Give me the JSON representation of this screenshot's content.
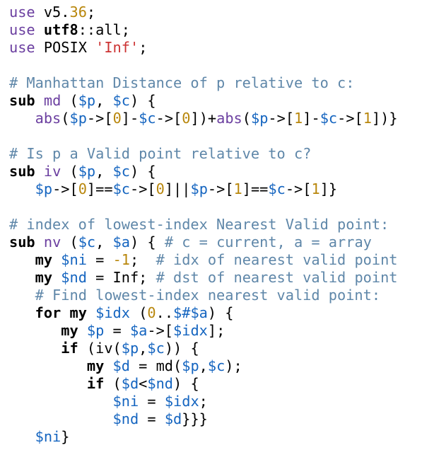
{
  "colors": {
    "keyword": "#000000",
    "pragma": "#6b3fa0",
    "number": "#b8860b",
    "string": "#cc3333",
    "comment": "#5f87a9",
    "variable": "#1565c0",
    "background": "#ffffff"
  },
  "lines": [
    [
      {
        "t": "pr",
        "v": "use"
      },
      {
        "t": "op",
        "v": " v5."
      },
      {
        "t": "num",
        "v": "36"
      },
      {
        "t": "op",
        "v": ";"
      }
    ],
    [
      {
        "t": "pr",
        "v": "use"
      },
      {
        "t": "op",
        "v": " "
      },
      {
        "t": "kw",
        "v": "utf8"
      },
      {
        "t": "op",
        "v": "::all;"
      }
    ],
    [
      {
        "t": "pr",
        "v": "use"
      },
      {
        "t": "op",
        "v": " POSIX "
      },
      {
        "t": "str",
        "v": "'Inf'"
      },
      {
        "t": "op",
        "v": ";"
      }
    ],
    [],
    [
      {
        "t": "cm",
        "v": "# Manhattan Distance of p relative to c:"
      }
    ],
    [
      {
        "t": "kw",
        "v": "sub"
      },
      {
        "t": "op",
        "v": " "
      },
      {
        "t": "fn",
        "v": "md"
      },
      {
        "t": "op",
        "v": " ("
      },
      {
        "t": "var",
        "v": "$p"
      },
      {
        "t": "op",
        "v": ", "
      },
      {
        "t": "var",
        "v": "$c"
      },
      {
        "t": "op",
        "v": ") {"
      }
    ],
    [
      {
        "t": "op",
        "v": "   "
      },
      {
        "t": "fn",
        "v": "abs"
      },
      {
        "t": "op",
        "v": "("
      },
      {
        "t": "var",
        "v": "$p"
      },
      {
        "t": "op",
        "v": "->["
      },
      {
        "t": "num",
        "v": "0"
      },
      {
        "t": "op",
        "v": "]-"
      },
      {
        "t": "var",
        "v": "$c"
      },
      {
        "t": "op",
        "v": "->["
      },
      {
        "t": "num",
        "v": "0"
      },
      {
        "t": "op",
        "v": "])+"
      },
      {
        "t": "fn",
        "v": "abs"
      },
      {
        "t": "op",
        "v": "("
      },
      {
        "t": "var",
        "v": "$p"
      },
      {
        "t": "op",
        "v": "->["
      },
      {
        "t": "num",
        "v": "1"
      },
      {
        "t": "op",
        "v": "]-"
      },
      {
        "t": "var",
        "v": "$c"
      },
      {
        "t": "op",
        "v": "->["
      },
      {
        "t": "num",
        "v": "1"
      },
      {
        "t": "op",
        "v": "])}"
      }
    ],
    [],
    [
      {
        "t": "cm",
        "v": "# Is p a Valid point relative to c?"
      }
    ],
    [
      {
        "t": "kw",
        "v": "sub"
      },
      {
        "t": "op",
        "v": " "
      },
      {
        "t": "fn",
        "v": "iv"
      },
      {
        "t": "op",
        "v": " ("
      },
      {
        "t": "var",
        "v": "$p"
      },
      {
        "t": "op",
        "v": ", "
      },
      {
        "t": "var",
        "v": "$c"
      },
      {
        "t": "op",
        "v": ") {"
      }
    ],
    [
      {
        "t": "op",
        "v": "   "
      },
      {
        "t": "var",
        "v": "$p"
      },
      {
        "t": "op",
        "v": "->["
      },
      {
        "t": "num",
        "v": "0"
      },
      {
        "t": "op",
        "v": "]=="
      },
      {
        "t": "var",
        "v": "$c"
      },
      {
        "t": "op",
        "v": "->["
      },
      {
        "t": "num",
        "v": "0"
      },
      {
        "t": "op",
        "v": "]||"
      },
      {
        "t": "var",
        "v": "$p"
      },
      {
        "t": "op",
        "v": "->["
      },
      {
        "t": "num",
        "v": "1"
      },
      {
        "t": "op",
        "v": "]=="
      },
      {
        "t": "var",
        "v": "$c"
      },
      {
        "t": "op",
        "v": "->["
      },
      {
        "t": "num",
        "v": "1"
      },
      {
        "t": "op",
        "v": "]}"
      }
    ],
    [],
    [
      {
        "t": "cm",
        "v": "# index of lowest-index Nearest Valid point:"
      }
    ],
    [
      {
        "t": "kw",
        "v": "sub"
      },
      {
        "t": "op",
        "v": " "
      },
      {
        "t": "fn",
        "v": "nv"
      },
      {
        "t": "op",
        "v": " ("
      },
      {
        "t": "var",
        "v": "$c"
      },
      {
        "t": "op",
        "v": ", "
      },
      {
        "t": "var",
        "v": "$a"
      },
      {
        "t": "op",
        "v": ") { "
      },
      {
        "t": "cm",
        "v": "# c = current, a = array"
      }
    ],
    [
      {
        "t": "op",
        "v": "   "
      },
      {
        "t": "kw",
        "v": "my"
      },
      {
        "t": "op",
        "v": " "
      },
      {
        "t": "var",
        "v": "$ni"
      },
      {
        "t": "op",
        "v": " = "
      },
      {
        "t": "num",
        "v": "-1"
      },
      {
        "t": "op",
        "v": ";  "
      },
      {
        "t": "cm",
        "v": "# idx of nearest valid point"
      }
    ],
    [
      {
        "t": "op",
        "v": "   "
      },
      {
        "t": "kw",
        "v": "my"
      },
      {
        "t": "op",
        "v": " "
      },
      {
        "t": "var",
        "v": "$nd"
      },
      {
        "t": "op",
        "v": " = Inf; "
      },
      {
        "t": "cm",
        "v": "# dst of nearest valid point"
      }
    ],
    [
      {
        "t": "op",
        "v": "   "
      },
      {
        "t": "cm",
        "v": "# Find lowest-index nearest valid point:"
      }
    ],
    [
      {
        "t": "op",
        "v": "   "
      },
      {
        "t": "kw",
        "v": "for"
      },
      {
        "t": "op",
        "v": " "
      },
      {
        "t": "kw",
        "v": "my"
      },
      {
        "t": "op",
        "v": " "
      },
      {
        "t": "var",
        "v": "$idx"
      },
      {
        "t": "op",
        "v": " ("
      },
      {
        "t": "num",
        "v": "0"
      },
      {
        "t": "op",
        "v": ".."
      },
      {
        "t": "var",
        "v": "$#$a"
      },
      {
        "t": "op",
        "v": ") {"
      }
    ],
    [
      {
        "t": "op",
        "v": "      "
      },
      {
        "t": "kw",
        "v": "my"
      },
      {
        "t": "op",
        "v": " "
      },
      {
        "t": "var",
        "v": "$p"
      },
      {
        "t": "op",
        "v": " = "
      },
      {
        "t": "var",
        "v": "$a"
      },
      {
        "t": "op",
        "v": "->["
      },
      {
        "t": "var",
        "v": "$idx"
      },
      {
        "t": "op",
        "v": "];"
      }
    ],
    [
      {
        "t": "op",
        "v": "      "
      },
      {
        "t": "kw",
        "v": "if"
      },
      {
        "t": "op",
        "v": " (iv("
      },
      {
        "t": "var",
        "v": "$p"
      },
      {
        "t": "op",
        "v": ","
      },
      {
        "t": "var",
        "v": "$c"
      },
      {
        "t": "op",
        "v": ")) {"
      }
    ],
    [
      {
        "t": "op",
        "v": "         "
      },
      {
        "t": "kw",
        "v": "my"
      },
      {
        "t": "op",
        "v": " "
      },
      {
        "t": "var",
        "v": "$d"
      },
      {
        "t": "op",
        "v": " = md("
      },
      {
        "t": "var",
        "v": "$p"
      },
      {
        "t": "op",
        "v": ","
      },
      {
        "t": "var",
        "v": "$c"
      },
      {
        "t": "op",
        "v": ");"
      }
    ],
    [
      {
        "t": "op",
        "v": "         "
      },
      {
        "t": "kw",
        "v": "if"
      },
      {
        "t": "op",
        "v": " ("
      },
      {
        "t": "var",
        "v": "$d"
      },
      {
        "t": "op",
        "v": "<"
      },
      {
        "t": "var",
        "v": "$nd"
      },
      {
        "t": "op",
        "v": ") {"
      }
    ],
    [
      {
        "t": "op",
        "v": "            "
      },
      {
        "t": "var",
        "v": "$ni"
      },
      {
        "t": "op",
        "v": " = "
      },
      {
        "t": "var",
        "v": "$idx"
      },
      {
        "t": "op",
        "v": ";"
      }
    ],
    [
      {
        "t": "op",
        "v": "            "
      },
      {
        "t": "var",
        "v": "$nd"
      },
      {
        "t": "op",
        "v": " = "
      },
      {
        "t": "var",
        "v": "$d"
      },
      {
        "t": "op",
        "v": "}}}"
      }
    ],
    [
      {
        "t": "op",
        "v": "   "
      },
      {
        "t": "var",
        "v": "$ni"
      },
      {
        "t": "op",
        "v": "}"
      }
    ]
  ]
}
